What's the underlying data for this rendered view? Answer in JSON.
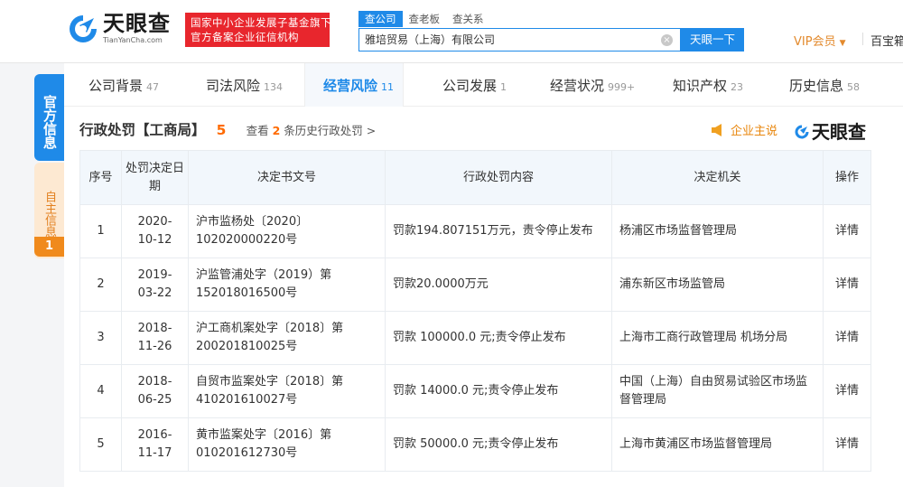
{
  "brand": {
    "name": "天眼查",
    "domain": "TianYanCha.com"
  },
  "promo": {
    "line1": "国家中小企业发展子基金旗下",
    "line2": "官方备案企业征信机构"
  },
  "search": {
    "tabs": [
      {
        "label": "查公司",
        "active": true
      },
      {
        "label": "查老板",
        "active": false
      },
      {
        "label": "查关系",
        "active": false
      }
    ],
    "value": "雅培贸易（上海）有限公司",
    "clear_glyph": "×",
    "button_label": "天眼一下"
  },
  "header": {
    "vip_label": "VIP会员",
    "vip_caret": "▼",
    "more_label": "百宝箱"
  },
  "side": {
    "official_label": "官方信息",
    "self_label": "自主信息",
    "self_badge": "1"
  },
  "nav": [
    {
      "label": "公司背景",
      "count": "47",
      "active": false
    },
    {
      "label": "司法风险",
      "count": "134",
      "active": false
    },
    {
      "label": "经营风险",
      "count": "11",
      "active": true
    },
    {
      "label": "公司发展",
      "count": "1",
      "active": false
    },
    {
      "label": "经营状况",
      "count": "999+",
      "active": false
    },
    {
      "label": "知识产权",
      "count": "23",
      "active": false
    },
    {
      "label": "历史信息",
      "count": "58",
      "active": false
    }
  ],
  "section": {
    "title": "行政处罚【工商局】",
    "count": "5",
    "history_prefix": "查看",
    "history_count": "2",
    "history_suffix": "条历史行政处罚 >",
    "claim_label": "企业主说",
    "brand_label": "天眼查"
  },
  "table": {
    "headers": [
      "序号",
      "处罚决定日期",
      "决定书文号",
      "行政处罚内容",
      "决定机关",
      "操作"
    ],
    "rows": [
      {
        "num": "1",
        "date": "2020-10-12",
        "doc": "沪市监杨处〔2020〕102020000220号",
        "content": "罚款194.807151万元，责令停止发布",
        "org": "杨浦区市场监督管理局",
        "op": "详情"
      },
      {
        "num": "2",
        "date": "2019-03-22",
        "doc": "沪监管浦处字（2019）第152018016500号",
        "content": "罚款20.0000万元",
        "org": "浦东新区市场监管局",
        "op": "详情"
      },
      {
        "num": "3",
        "date": "2018-11-26",
        "doc": "沪工商机案处字〔2018〕第200201810025号",
        "content": "罚款 100000.0 元;责令停止发布",
        "org": "上海市工商行政管理局 机场分局",
        "op": "详情"
      },
      {
        "num": "4",
        "date": "2018-06-25",
        "doc": "自贸市监案处字〔2018〕第410201610027号",
        "content": "罚款 14000.0 元;责令停止发布",
        "org": "中国（上海）自由贸易试验区市场监督管理局",
        "op": "详情"
      },
      {
        "num": "5",
        "date": "2016-11-17",
        "doc": "黄市监案处字〔2016〕第010201612730号",
        "content": "罚款 50000.0 元;责令停止发布",
        "org": "上海市黄浦区市场监督管理局",
        "op": "详情"
      }
    ]
  },
  "colors": {
    "accent": "#1f8ae8",
    "promo_red": "#e8262d",
    "count_orange": "#ff6a00",
    "vip_gold": "#e38a2d",
    "self_tab_bg": "#fde9d2",
    "self_badge": "#f08a1c"
  },
  "icons": {
    "logo": "tianyancha-logo-icon",
    "clear": "clear-icon",
    "claim": "megaphone-icon",
    "caret": "caret-down-icon"
  }
}
